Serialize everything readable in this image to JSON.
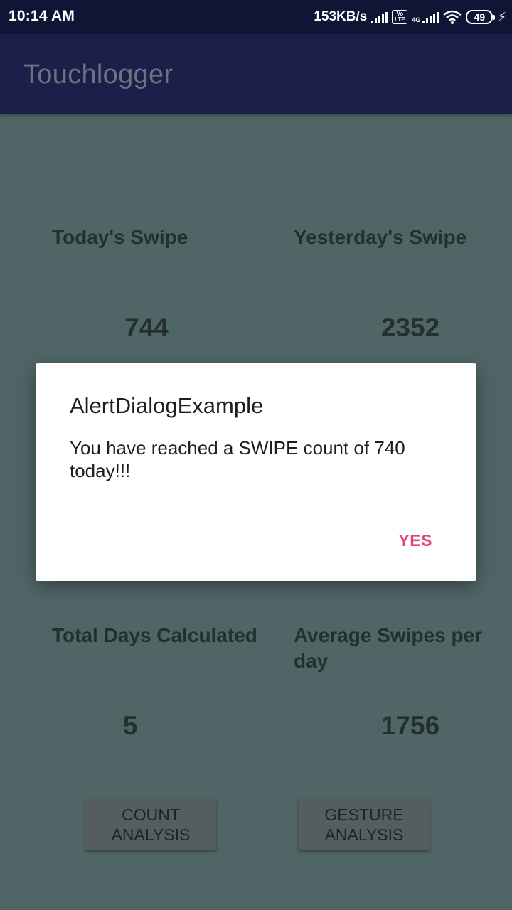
{
  "status_bar": {
    "time": "10:14 AM",
    "net_speed": "153KB/s",
    "volte": "Vo LTE",
    "network": "4G",
    "battery": "49"
  },
  "app_bar": {
    "title": "Touchlogger"
  },
  "stats": {
    "today_label": "Today's Swipe",
    "today_value": "744",
    "yesterday_label": "Yesterday's Swipe",
    "yesterday_value": "2352",
    "total_days_label": "Total Days Calculated",
    "total_days_value": "5",
    "average_label": "Average Swipes per day",
    "average_value": "1756"
  },
  "buttons": {
    "count_analysis": "COUNT ANALYSIS",
    "gesture_analysis": "GESTURE ANALYSIS"
  },
  "dialog": {
    "title": "AlertDialogExample",
    "message": "You have reached a SWIPE count of 740 today!!!",
    "positive_button": "YES"
  },
  "colors": {
    "status_bar": "#0f1635",
    "app_bar": "#1a2049",
    "background_dimmed": "#4f6566",
    "dialog_accent": "#e2437e"
  }
}
